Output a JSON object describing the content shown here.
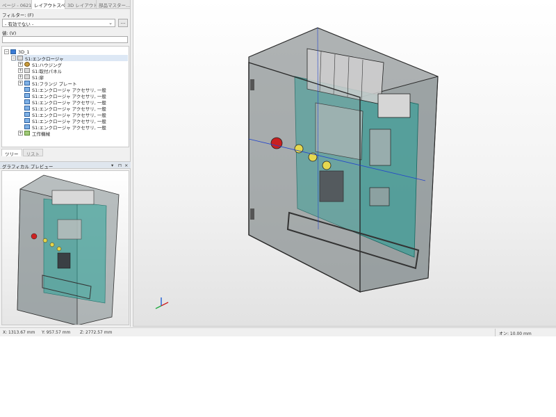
{
  "tabs": [
    "ページ - 0621...",
    "レイアウトスペ...",
    "3D レイアウト...",
    "部品マスター..."
  ],
  "filter": {
    "label": "フィルター: (F)",
    "value": "- 有効でない -",
    "more_button": "..."
  },
  "search": {
    "label": "値: (V)",
    "value": ""
  },
  "tree": {
    "root": "3D_1",
    "enclosure": "S1:エンクロージャ",
    "children": [
      "S1:ハウジング",
      "S1:取付パネル",
      "S1:扉",
      "S1:フランジ プレート",
      "S1:エンクロージャ アクセサリ, 一般",
      "S1:エンクロージャ アクセサリ, 一般",
      "S1:エンクロージャ アクセサリ, 一般",
      "S1:エンクロージャ アクセサリ, 一般",
      "S1:エンクロージャ アクセサリ, 一般",
      "S1:エンクロージャ アクセサリ, 一般",
      "S1:エンクロージャ アクセサリ, 一般"
    ],
    "last": "工作機械"
  },
  "bottom_tabs": [
    "ツリー",
    "リスト"
  ],
  "preview": {
    "title": "グラフィカル プレビュー",
    "pin": "▾",
    "float": "⊓",
    "close": "×"
  },
  "status": {
    "x": "X:  1313.67 mm",
    "y": "Y:  957.57 mm",
    "z": "Z:  2772.57 mm",
    "snap": "オン: 10.00 mm"
  },
  "icons": {
    "expand": "plus-box-icon",
    "collapse": "minus-box-icon"
  }
}
